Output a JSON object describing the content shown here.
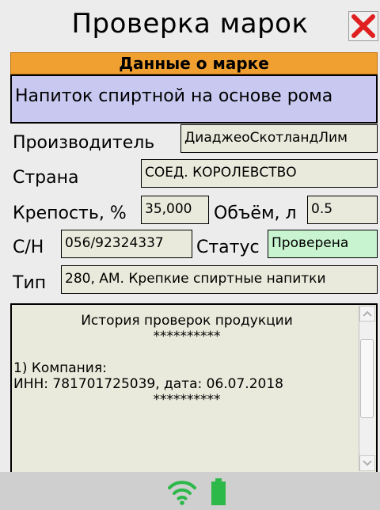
{
  "window": {
    "title": "Проверка марок"
  },
  "section": {
    "header": "Данные о марке"
  },
  "product": {
    "name": "Напиток спиртной на основе рома"
  },
  "fields": {
    "manufacturer_label": "Производитель",
    "manufacturer_value": "ДиаджеоСкотландЛим",
    "country_label": "Страна",
    "country_value": "СОЕД. КОРОЛЕВСТВО",
    "strength_label": "Крепость, %",
    "strength_value": "35,000",
    "volume_label": "Объём, л",
    "volume_value": "0.5",
    "serial_label": "С/Н",
    "serial_value": "056/92324337",
    "status_label": "Статус",
    "status_value": "Проверена",
    "type_label": "Тип",
    "type_value": "280, АМ. Крепкие спиртные напитки"
  },
  "history": {
    "title": "История проверок продукции",
    "separator": "**********",
    "line1": "1) Компания:",
    "line2": "ИНН: 781701725039, дата: 06.07.2018",
    "separator2": "**********"
  },
  "icons": {
    "close": "close-icon",
    "wifi": "wifi-icon",
    "battery": "battery-icon"
  },
  "colors": {
    "header_orange": "#f0a030",
    "product_lavender": "#c8c8f0",
    "status_green": "#c8f5d0",
    "field_bg": "#eaeadc",
    "close_red": "#e02020",
    "icon_green": "#2db84a"
  }
}
